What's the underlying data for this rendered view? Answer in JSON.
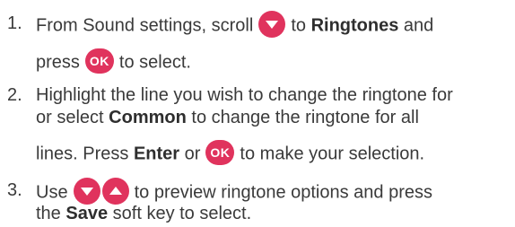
{
  "colors": {
    "icon_accent": "#e0335d",
    "text": "#3a3a3a"
  },
  "steps": [
    {
      "number": "1.",
      "lines": [
        {
          "a": "From Sound settings, scroll",
          "icon": "down-arrow-icon",
          "b": "to",
          "bold": "Ringtones",
          "c": "and"
        },
        {
          "a": "press",
          "icon": "ok-icon",
          "ok_label": "OK",
          "b": "to select."
        }
      ]
    },
    {
      "number": "2.",
      "lines": [
        {
          "text": "Highlight the line you wish to change the ringtone for"
        },
        {
          "a": "or select",
          "bold": "Common",
          "b": "to change the ringtone for all"
        },
        {
          "a": "lines. Press",
          "bold": "Enter",
          "b": "or",
          "icon": "ok-icon",
          "ok_label": "OK",
          "c": "to make your selection."
        }
      ]
    },
    {
      "number": "3.",
      "lines": [
        {
          "a": "Use",
          "icons": [
            "down-arrow-icon",
            "up-arrow-icon"
          ],
          "b": "to preview ringtone options and press"
        },
        {
          "a": "the",
          "bold": "Save",
          "b": "soft key to select."
        }
      ]
    }
  ]
}
